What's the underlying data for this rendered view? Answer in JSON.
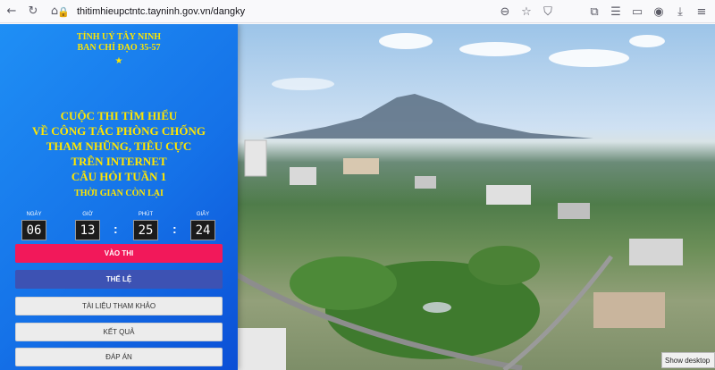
{
  "browser": {
    "url": "thitimhieupctntc.tayninh.gov.vn/dangky",
    "icons": [
      "back-icon",
      "refresh-icon",
      "home-icon",
      "lock-icon",
      "zoom-icon",
      "star-icon",
      "shield-icon",
      "extensions-icon",
      "bookmarks-icon",
      "sidebar-icon",
      "account-icon",
      "download-icon",
      "menu-icon"
    ]
  },
  "header": {
    "org_line1": "TỈNH UỶ TÂY NINH",
    "org_line2": "BAN CHỈ ĐẠO 35-57",
    "star": "★"
  },
  "contest": {
    "title_lines": [
      "CUỘC THI TÌM HIỂU",
      "VỀ CÔNG TÁC PHÒNG CHỐNG",
      "THAM NHŨNG, TIÊU CỰC",
      "TRÊN INTERNET"
    ],
    "week": "CÂU HỎI TUẦN 1",
    "remaining_label": "THỜI GIAN CÒN LẠI"
  },
  "countdown": {
    "days_label": "NGÀY",
    "days": "06",
    "hours_label": "GIỜ",
    "hours": "13",
    "minutes_label": "PHÚT",
    "minutes": "25",
    "seconds_label": "GIÂY",
    "seconds": "24",
    "separator": ":"
  },
  "buttons": {
    "enter": "VÀO THI",
    "rules": "THỂ LỆ",
    "docs": "TÀI LIỆU THAM KHẢO",
    "results": "KẾT QUẢ",
    "answers": "ĐÁP ÁN"
  },
  "colors": {
    "panel": "#1572e8",
    "accent_text": "#ffe600",
    "enter_button": "#f2185a",
    "rules_button": "#3d52b3"
  },
  "tooltip": "Show desktop"
}
